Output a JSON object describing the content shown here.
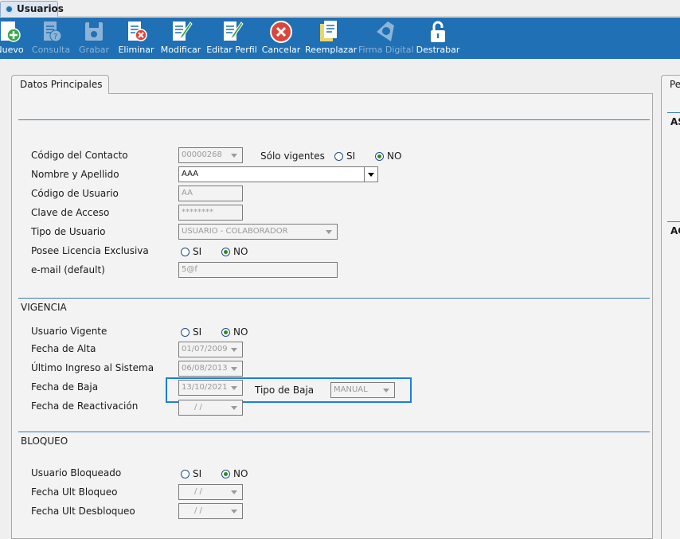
{
  "window_tab": {
    "title": "Usuarios"
  },
  "toolbar": {
    "items": [
      {
        "label": "Nuevo",
        "icon": "new-icon",
        "enabled": true
      },
      {
        "label": "Consulta",
        "icon": "query-icon",
        "enabled": false
      },
      {
        "label": "Grabar",
        "icon": "save-icon",
        "enabled": false
      },
      {
        "label": "Eliminar",
        "icon": "delete-icon",
        "enabled": true
      },
      {
        "label": "Modificar",
        "icon": "edit-icon",
        "enabled": true
      },
      {
        "label": "Editar Perfil",
        "icon": "edit-profile-icon",
        "enabled": true
      },
      {
        "label": "Cancelar",
        "icon": "cancel-icon",
        "enabled": true
      },
      {
        "label": "Reemplazar",
        "icon": "replace-icon",
        "enabled": true
      },
      {
        "label": "Firma Digital",
        "icon": "digital-signature-icon",
        "enabled": false
      },
      {
        "label": "Destrabar",
        "icon": "unlock-icon",
        "enabled": true
      }
    ]
  },
  "main_tab": {
    "label": "Datos Principales"
  },
  "right_tab": {
    "label": "Pe",
    "section1": "AS",
    "section2": "AC"
  },
  "contact": {
    "codigo_label": "Código del Contacto",
    "codigo_value": "00000268",
    "solo_vigentes_label": "Sólo vigentes",
    "solo_vigentes_si": "SI",
    "solo_vigentes_no": "NO",
    "solo_vigentes_selected": "NO",
    "nombre_label": "Nombre y Apellido",
    "nombre_value": "AAA",
    "codigo_usuario_label": "Código de Usuario",
    "codigo_usuario_value": "AA",
    "clave_label": "Clave de Acceso",
    "clave_value": "********",
    "tipo_usuario_label": "Tipo de Usuario",
    "tipo_usuario_value": "USUARIO - COLABORADOR",
    "licencia_label": "Posee Licencia Exclusiva",
    "licencia_si": "SI",
    "licencia_no": "NO",
    "licencia_selected": "NO",
    "email_label": "e-mail (default)",
    "email_value": "5@f"
  },
  "vigencia": {
    "title": "VIGENCIA",
    "usuario_vigente_label": "Usuario Vigente",
    "usuario_vigente_si": "SI",
    "usuario_vigente_no": "NO",
    "usuario_vigente_selected": "NO",
    "fecha_alta_label": "Fecha de Alta",
    "fecha_alta_value": "01/07/2009",
    "ultimo_ingreso_label": "Último Ingreso al Sistema",
    "ultimo_ingreso_value": "06/08/2013",
    "fecha_baja_label": "Fecha de Baja",
    "fecha_baja_value": "13/10/2021",
    "tipo_baja_label": "Tipo de Baja",
    "tipo_baja_value": "MANUAL",
    "fecha_reactivacion_label": "Fecha de Reactivación",
    "fecha_reactivacion_value": "/ /"
  },
  "bloqueo": {
    "title": "BLOQUEO",
    "usuario_bloqueado_label": "Usuario Bloqueado",
    "usuario_bloqueado_si": "SI",
    "usuario_bloqueado_no": "NO",
    "usuario_bloqueado_selected": "NO",
    "fecha_ult_bloqueo_label": "Fecha Ult Bloqueo",
    "fecha_ult_bloqueo_value": "/ /",
    "fecha_ult_desbloqueo_label": "Fecha Ult Desbloqueo",
    "fecha_ult_desbloqueo_value": "/ /"
  },
  "colors": {
    "toolbar": "#1f70b4",
    "accent": "#3a7dbd",
    "highlight": "#1b7ee0"
  }
}
